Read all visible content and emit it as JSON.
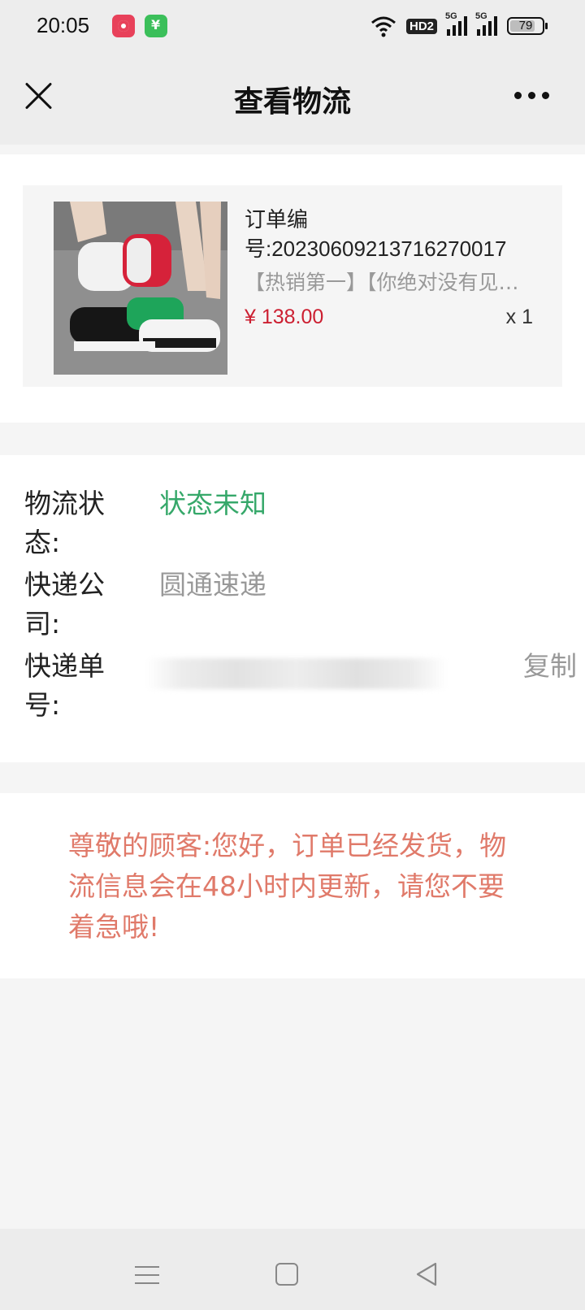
{
  "status_bar": {
    "time": "20:05",
    "network_badge": "HD2",
    "signal_1_label": "5G",
    "signal_2_label": "5G",
    "battery": "79"
  },
  "navbar": {
    "title": "查看物流"
  },
  "order": {
    "number_label": "订单编",
    "number": "号:20230609213716270017",
    "description": "【热销第一】【你绝对没有见过的超轻运动鞋】",
    "price": "¥ 138.00",
    "quantity": "x 1"
  },
  "logistics": {
    "status_label": "物流状态:",
    "status_value": "状态未知",
    "company_label": "快递公司:",
    "company_value": "圆通速递",
    "tracking_label": "快递单号:",
    "copy_label": "复制"
  },
  "notice": {
    "text": "尊敬的顾客:您好，订单已经发货，物流信息会在48小时内更新，请您不要着急哦!"
  },
  "colors": {
    "status_green": "#36a86a",
    "price_red": "#cc1f31",
    "notice_red": "#e07a6a"
  }
}
